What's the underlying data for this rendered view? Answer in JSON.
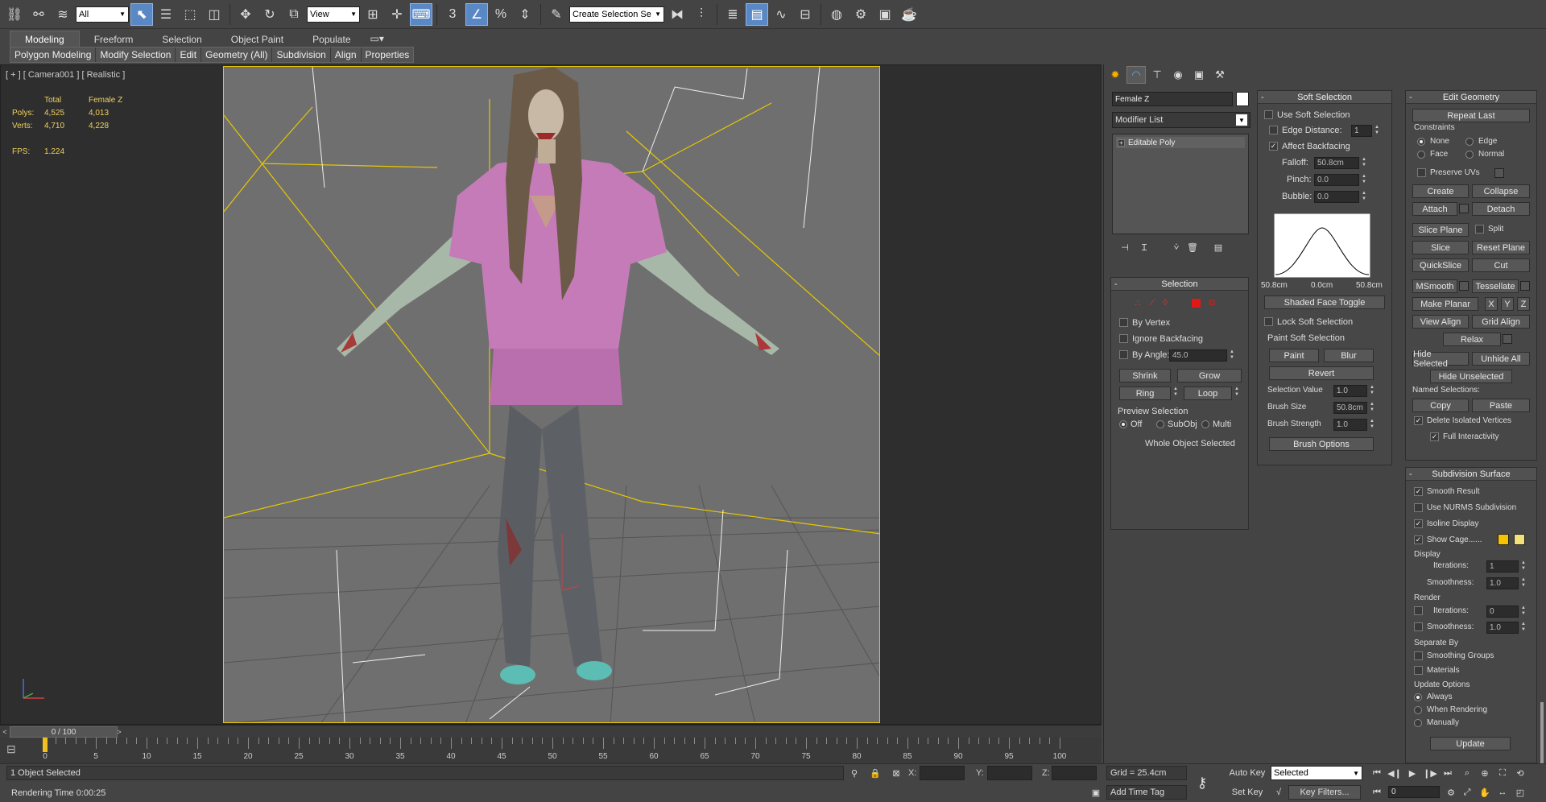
{
  "toolbar": {
    "filter_value": "All",
    "refcoord_value": "View",
    "named_selection_placeholder": "Create Selection Se",
    "snap_label": "3",
    "percent_label": "%"
  },
  "ribbon": {
    "tabs": [
      "Modeling",
      "Freeform",
      "Selection",
      "Object Paint",
      "Populate"
    ],
    "subtabs": [
      "Polygon Modeling",
      "Modify Selection",
      "Edit",
      "Geometry (All)",
      "Subdivision",
      "Align",
      "Properties"
    ]
  },
  "viewport": {
    "label": "[ + ] [ Camera001 ] [ Realistic ]",
    "stats": {
      "col_total": "Total",
      "col_object": "Female Z",
      "polys_label": "Polys:",
      "polys_total": "4,525",
      "polys_object": "4,013",
      "verts_label": "Verts:",
      "verts_total": "4,710",
      "verts_object": "4,228",
      "fps_label": "FPS:",
      "fps_value": "1.224"
    }
  },
  "timeline": {
    "slider_value": "0 / 100",
    "prev_arrow": "<",
    "next_arrow": ">",
    "ticks": [
      "0",
      "5",
      "10",
      "15",
      "20",
      "25",
      "30",
      "35",
      "40",
      "45",
      "50",
      "55",
      "60",
      "65",
      "70",
      "75",
      "80",
      "85",
      "90",
      "95",
      "100"
    ]
  },
  "status": {
    "selection_text": "1 Object Selected",
    "render_time": "Rendering Time  0:00:25",
    "x_label": "X:",
    "y_label": "Y:",
    "z_label": "Z:",
    "grid": "Grid = 25.4cm",
    "add_time_tag": "Add Time Tag",
    "auto_key": "Auto Key",
    "set_key": "Set Key",
    "key_mode_value": "Selected",
    "key_filters": "Key Filters...",
    "frame_value": "0"
  },
  "modifier_panel": {
    "object_name": "Female Z",
    "modifier_list": "Modifier List",
    "stack_item": "Editable Poly",
    "selection": {
      "title": "Selection",
      "by_vertex": "By Vertex",
      "ignore_backfacing": "Ignore Backfacing",
      "by_angle": "By Angle:",
      "angle_value": "45.0",
      "shrink": "Shrink",
      "grow": "Grow",
      "ring": "Ring",
      "loop": "Loop",
      "preview_title": "Preview Selection",
      "preview_off": "Off",
      "preview_subobj": "SubObj",
      "preview_multi": "Multi",
      "status": "Whole Object Selected"
    }
  },
  "soft_selection": {
    "title": "Soft Selection",
    "use_soft": "Use Soft Selection",
    "edge_distance": "Edge Distance:",
    "edge_distance_value": "1",
    "affect_backfacing": "Affect Backfacing",
    "falloff": "Falloff:",
    "falloff_value": "50.8cm",
    "pinch": "Pinch:",
    "pinch_value": "0.0",
    "bubble": "Bubble:",
    "bubble_value": "0.0",
    "curve_left": "50.8cm",
    "curve_mid": "0.0cm",
    "curve_right": "50.8cm",
    "shaded_face_toggle": "Shaded Face Toggle",
    "lock_soft": "Lock Soft Selection",
    "paint_group": "Paint Soft Selection",
    "paint": "Paint",
    "blur": "Blur",
    "revert": "Revert",
    "selection_value": "Selection Value",
    "selection_value_num": "1.0",
    "brush_size": "Brush Size",
    "brush_size_value": "50.8cm",
    "brush_strength": "Brush Strength",
    "brush_strength_value": "1.0",
    "brush_options": "Brush Options"
  },
  "edit_geometry": {
    "title": "Edit Geometry",
    "repeat_last": "Repeat Last",
    "constraints": "Constraints",
    "none": "None",
    "edge": "Edge",
    "face": "Face",
    "normal": "Normal",
    "preserve_uvs": "Preserve UVs",
    "create": "Create",
    "collapse": "Collapse",
    "attach": "Attach",
    "detach": "Detach",
    "slice_plane": "Slice Plane",
    "split": "Split",
    "slice": "Slice",
    "reset_plane": "Reset Plane",
    "quickslice": "QuickSlice",
    "cut": "Cut",
    "msmooth": "MSmooth",
    "tessellate": "Tessellate",
    "make_planar": "Make Planar",
    "x": "X",
    "y": "Y",
    "z": "Z",
    "view_align": "View Align",
    "grid_align": "Grid Align",
    "relax": "Relax",
    "hide_selected": "Hide Selected",
    "unhide_all": "Unhide All",
    "hide_unselected": "Hide Unselected",
    "named_selections": "Named Selections:",
    "copy": "Copy",
    "paste": "Paste",
    "delete_isolated": "Delete Isolated Vertices",
    "full_interactivity": "Full Interactivity"
  },
  "subdivision": {
    "title": "Subdivision Surface",
    "smooth_result": "Smooth Result",
    "use_nurms": "Use NURMS Subdivision",
    "isoline": "Isoline Display",
    "show_cage": "Show Cage......",
    "cage_color_1": "#f5c400",
    "cage_color_2": "#f3e27a",
    "display": "Display",
    "iterations": "Iterations:",
    "display_iterations": "1",
    "smoothness": "Smoothness:",
    "display_smoothness": "1.0",
    "render": "Render",
    "render_iterations": "0",
    "render_smoothness": "1.0",
    "separate_by": "Separate By",
    "smoothing_groups": "Smoothing Groups",
    "materials": "Materials",
    "update_options": "Update Options",
    "always": "Always",
    "when_rendering": "When Rendering",
    "manually": "Manually",
    "update": "Update"
  },
  "colors": {
    "accent": "#5a88c5",
    "camera_frame": "#e6c800",
    "stats_text": "#f0d060",
    "viewport_bg": "#6f6f6f"
  }
}
